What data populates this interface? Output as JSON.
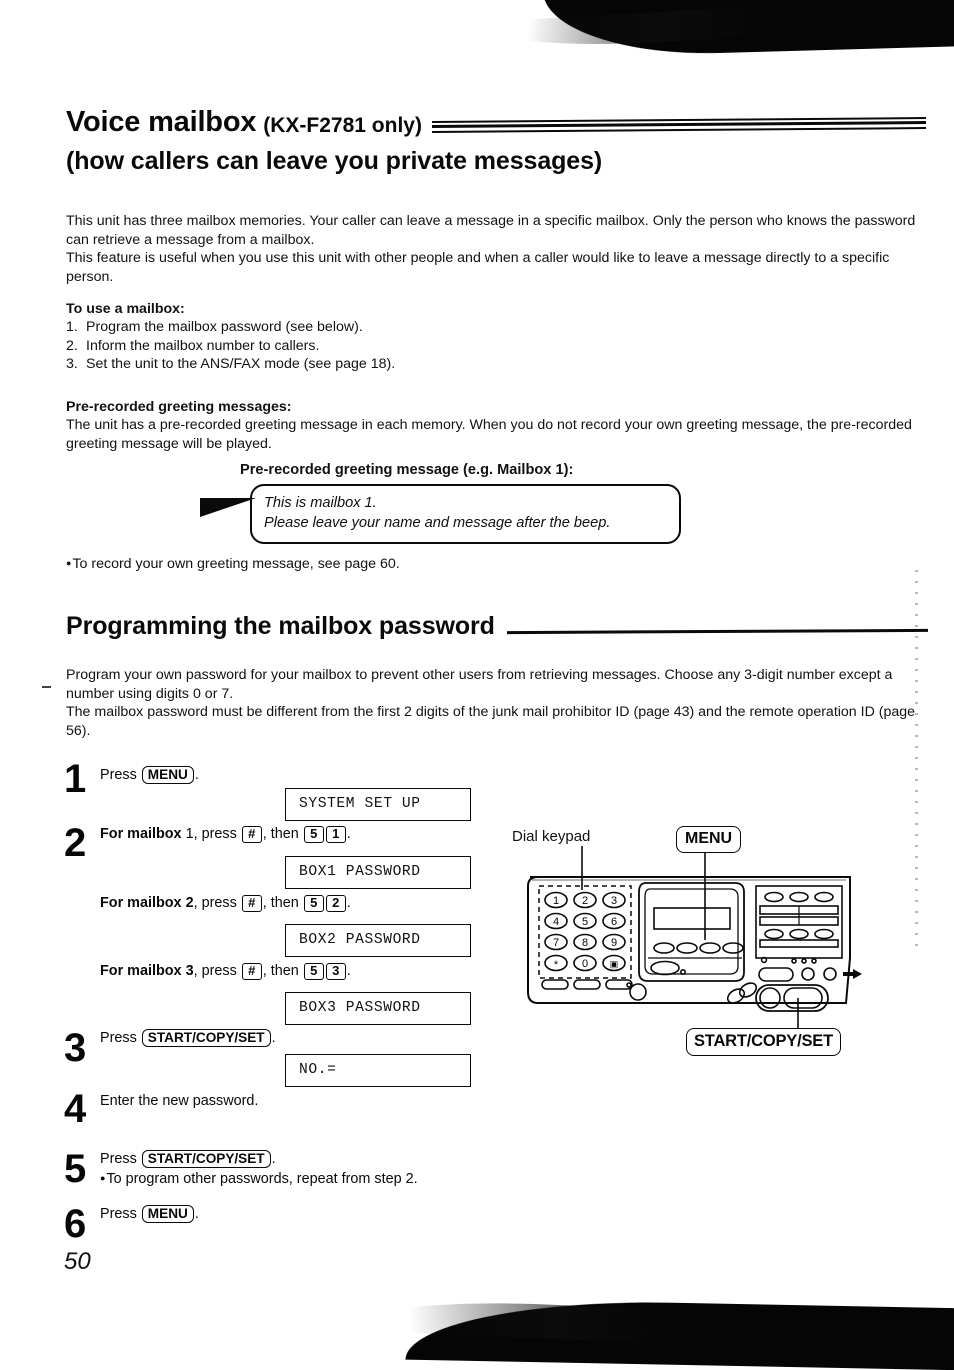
{
  "document": {
    "page_number": "50",
    "title_main": "Voice mailbox",
    "title_model": "(KX-F2781 only)",
    "title_line2": "(how callers can leave you private messages)",
    "section_heading": "Programming the mailbox password"
  },
  "intro": {
    "paragraph1": "This unit has three mailbox memories. Your caller can leave a message in a specific mailbox. Only the person who knows the password can retrieve a message from a mailbox.",
    "paragraph2": "This feature is useful when you use this unit with other people and when a caller would like to leave a message directly to a specific person."
  },
  "to_use_mailbox": {
    "heading": "To use a mailbox:",
    "items": [
      {
        "number": "1.",
        "text": "Program the mailbox password (see below)."
      },
      {
        "number": "2.",
        "text": "Inform the mailbox number to callers."
      },
      {
        "number": "3.",
        "text": "Set the unit to the ANS/FAX mode (see page 18)."
      }
    ]
  },
  "prerecorded": {
    "heading": "Pre-recorded greeting messages:",
    "body": "The unit has a pre-recorded greeting message in each memory. When you do not record your own greeting message, the pre-recorded greeting message will be played.",
    "example_caption": "Pre-recorded greeting message (e.g. Mailbox 1):",
    "balloon_line1": "This is mailbox 1.",
    "balloon_line2": "Please leave your name and message after the beep.",
    "note": "To record your own greeting message, see page 60."
  },
  "password_section": {
    "paragraph1": "Program your own password for your mailbox to prevent other users from retrieving messages. Choose any 3-digit number except a number using digits 0 or 7.",
    "paragraph2": "The mailbox password must be different from the first 2 digits of the junk mail prohibitor ID (page 43) and the remote operation ID (page 56)."
  },
  "steps": {
    "step1": {
      "number": "1",
      "press_word": "Press",
      "key": "MENU",
      "period": ".",
      "lcd": "SYSTEM SET UP"
    },
    "step2": {
      "number": "2",
      "mailbox1": {
        "lead": "For mailbox",
        "box_no": "1",
        "press_word": ", press",
        "key_hash": "#",
        "then_word": ", then",
        "key_a": "5",
        "key_b": "1",
        "period": ".",
        "lcd": "BOX1 PASSWORD"
      },
      "mailbox2": {
        "lead": "For mailbox",
        "box_no": "2",
        "press_word": ", press",
        "key_hash": "#",
        "then_word": ", then",
        "key_a": "5",
        "key_b": "2",
        "period": ".",
        "lcd": "BOX2 PASSWORD"
      },
      "mailbox3": {
        "lead": "For mailbox",
        "box_no": "3",
        "press_word": ", press",
        "key_hash": "#",
        "then_word": ", then",
        "key_a": "5",
        "key_b": "3",
        "period": ".",
        "lcd": "BOX3 PASSWORD"
      }
    },
    "step3": {
      "number": "3",
      "press_word": "Press",
      "key": "START/COPY/SET",
      "period": ".",
      "lcd": "NO.="
    },
    "step4": {
      "number": "4",
      "text": "Enter the new password."
    },
    "step5": {
      "number": "5",
      "press_word": "Press",
      "key": "START/COPY/SET",
      "period": ".",
      "note": "To program other passwords, repeat from step 2."
    },
    "step6": {
      "number": "6",
      "press_word": "Press",
      "key": "MENU",
      "period": "."
    }
  },
  "figure": {
    "dial_keypad_label": "Dial keypad",
    "menu_callout": "MENU",
    "start_callout": "START/COPY/SET",
    "keypad_keys": [
      "1",
      "2",
      "3",
      "4",
      "5",
      "6",
      "7",
      "8",
      "9",
      "*",
      "0",
      "#"
    ]
  },
  "colors": {
    "ink": "#0a0a0a",
    "paper": "#ffffff"
  }
}
